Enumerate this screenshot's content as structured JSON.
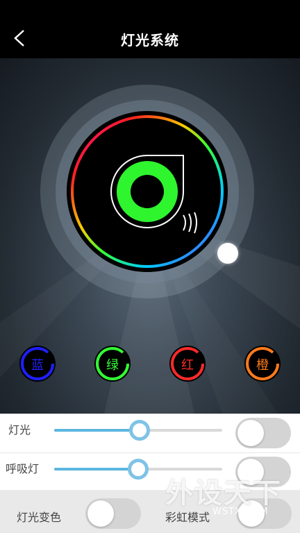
{
  "header": {
    "title": "灯光系统"
  },
  "colors": {
    "blue": {
      "label": "蓝",
      "hex": "#1f1fff",
      "ring": "#0000cc"
    },
    "green": {
      "label": "绿",
      "hex": "#33ff33",
      "ring": "#00cc00"
    },
    "red": {
      "label": "红",
      "hex": "#ff2a2a",
      "ring": "#dd0000"
    },
    "orange": {
      "label": "橙",
      "hex": "#ff7a1a",
      "ring": "#ff6600"
    }
  },
  "dial": {
    "center_color": "#2ef52e",
    "icon": "lamp-ring-icon"
  },
  "controls": {
    "light": {
      "label": "灯光",
      "value_percent": 51,
      "toggle_on": false
    },
    "breath": {
      "label": "呼吸灯",
      "value_percent": 50,
      "toggle_on": false
    },
    "color_change": {
      "label": "灯光变色",
      "toggle_on": false
    },
    "rainbow": {
      "label": "彩虹模式",
      "toggle_on": false
    }
  },
  "watermark": {
    "cn": "外设天下",
    "en": "WSTX.COM"
  }
}
